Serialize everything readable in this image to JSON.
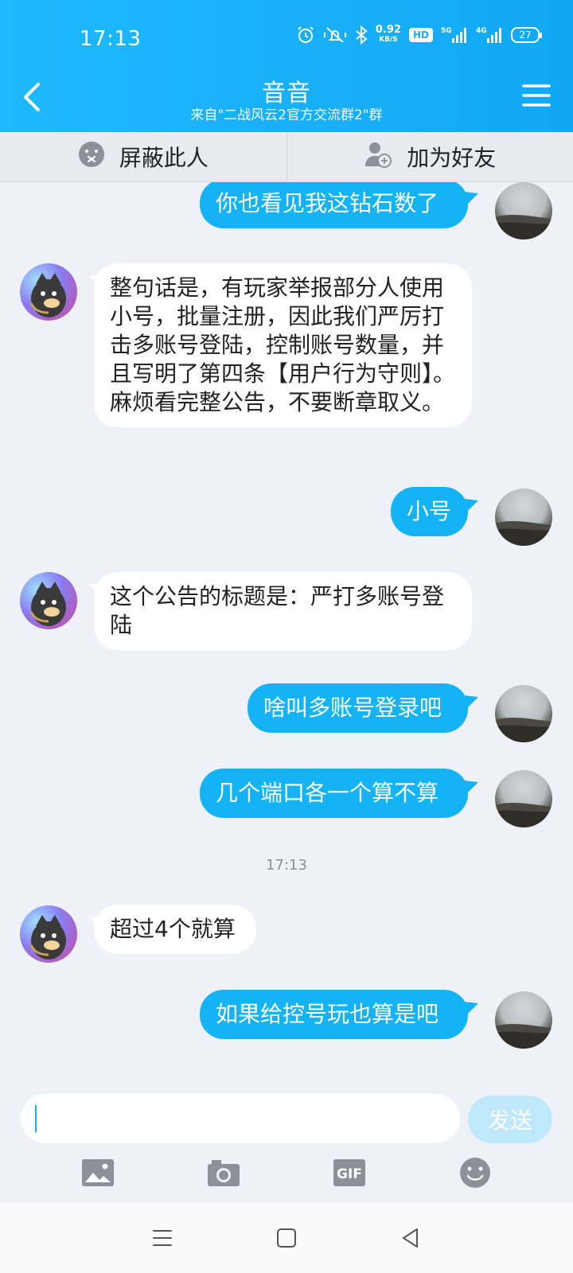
{
  "status": {
    "time": "17:13",
    "speed_value": "0.92",
    "speed_unit": "KB/S",
    "hd_label": "HD",
    "network_1": "5G",
    "network_2": "4G",
    "battery": "27"
  },
  "header": {
    "title": "音音",
    "subtitle": "来自\"二战风云2官方交流群2\"群"
  },
  "actions": {
    "block_label": "屏蔽此人",
    "add_friend_label": "加为好友"
  },
  "messages": [
    {
      "sender": "me",
      "text": "你也看见我这钻石数了"
    },
    {
      "sender": "other",
      "text": "整句话是，有玩家举报部分人使用小号，批量注册，因此我们严厉打击多账号登陆，控制账号数量，并且写明了第四条【用户行为守则】。麻烦看完整公告，不要断章取义。"
    },
    {
      "sender": "me",
      "text": "小号"
    },
    {
      "sender": "other",
      "text": "这个公告的标题是：严打多账号登陆"
    },
    {
      "sender": "me",
      "text": "啥叫多账号登录吧"
    },
    {
      "sender": "me",
      "text": "几个端口各一个算不算"
    },
    {
      "sender": "other",
      "text": "超过4个就算"
    },
    {
      "sender": "me",
      "text": "如果给控号玩也算是吧"
    }
  ],
  "timestamp": "17:13",
  "composer": {
    "input_value": "",
    "send_label": "发送"
  },
  "toolbar": {
    "gif_label": "GIF"
  },
  "colors": {
    "header": "#14b3f6",
    "bubble_me": "#14b3f6",
    "bubble_other": "#ffffff",
    "background": "#eef1f7"
  }
}
